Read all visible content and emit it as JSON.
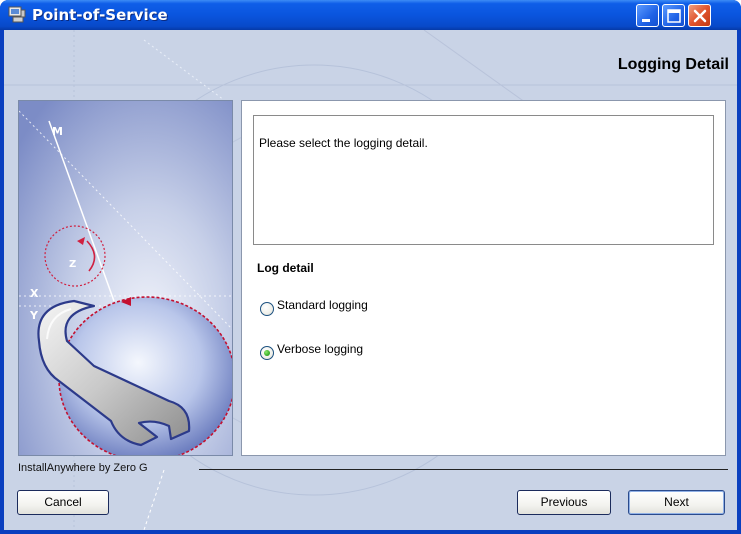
{
  "window": {
    "title": "Point-of-Service"
  },
  "header": {
    "title": "Logging Detail"
  },
  "panel": {
    "instructions": "Please select the logging detail.",
    "section_label": "Log detail",
    "options": [
      {
        "label": "Standard logging",
        "selected": false
      },
      {
        "label": "Verbose logging",
        "selected": true
      }
    ]
  },
  "side_image": {
    "axis_labels": [
      "M",
      "Z",
      "X",
      "Y"
    ]
  },
  "footer": {
    "brand": "InstallAnywhere by Zero G",
    "cancel_label": "Cancel",
    "previous_label": "Previous",
    "next_label": "Next"
  },
  "colors": {
    "titlebar": "#0a55de",
    "client_bg": "#c9d3e6",
    "close_button": "#e0542e",
    "radio_selected": "#3ab02a"
  },
  "icons": [
    "app-icon",
    "minimize-icon",
    "maximize-icon",
    "close-icon"
  ]
}
